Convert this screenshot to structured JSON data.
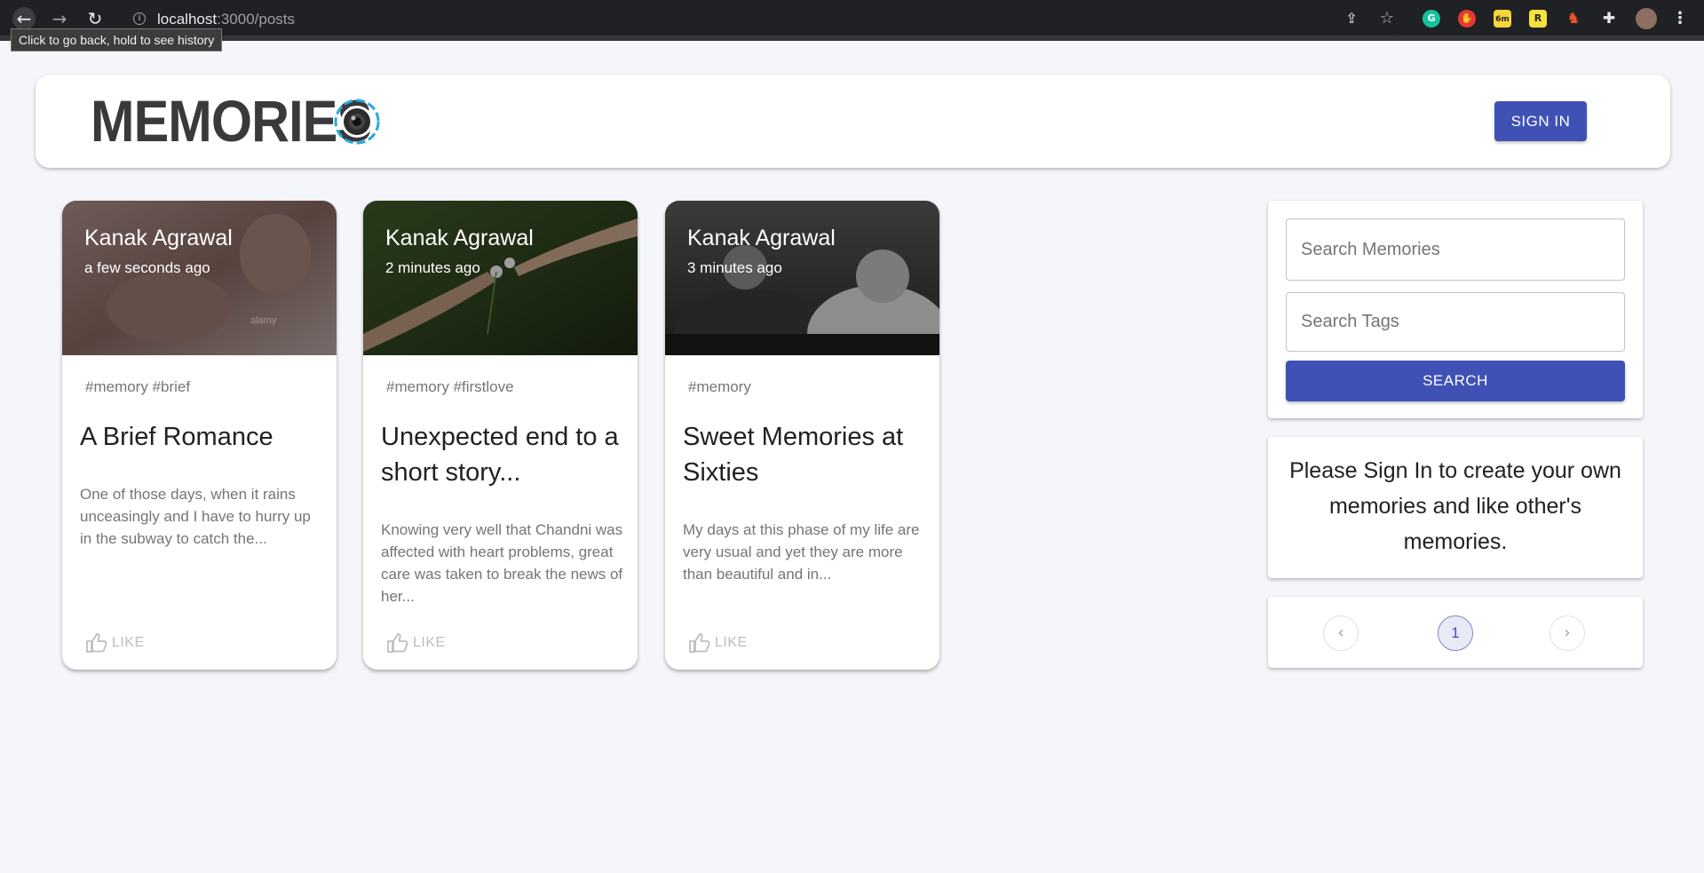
{
  "browser": {
    "url_host": "localhost",
    "url_path": ":3000/posts",
    "tooltip": "Click to go back, hold to see history",
    "extension_badge": "6m"
  },
  "header": {
    "brand": "MEMORIES",
    "signin_label": "SIGN IN"
  },
  "posts": [
    {
      "author": "Kanak Agrawal",
      "time": "a few seconds ago",
      "tags": "#memory #brief",
      "title": "A Brief Romance",
      "message": "One of those days, when it rains unceasingly and I have to hurry up in the subway to catch the...",
      "like_label": "LIKE",
      "image_watermark": "alamy"
    },
    {
      "author": "Kanak Agrawal",
      "time": "2 minutes ago",
      "tags": "#memory #firstlove",
      "title": "Unexpected end to a short story...",
      "message": "Knowing very well that Chandni was affected with heart problems, great care was taken to break the news of her...",
      "like_label": "LIKE"
    },
    {
      "author": "Kanak Agrawal",
      "time": "3 minutes ago",
      "tags": "#memory",
      "title": "Sweet Memories at Sixties",
      "message": "My days at this phase of my life are very usual and yet they are more than beautiful and in...",
      "like_label": "LIKE"
    }
  ],
  "sidebar": {
    "search_memories_placeholder": "Search Memories",
    "search_tags_placeholder": "Search Tags",
    "search_label": "SEARCH",
    "signin_message": "Please Sign In to create your own memories and like other's memories.",
    "pagination": {
      "current_page": "1",
      "prev_icon": "chevron-left-icon",
      "next_icon": "chevron-right-icon"
    }
  },
  "colors": {
    "primary": "#3f51b5",
    "background": "#f5f6fa"
  }
}
